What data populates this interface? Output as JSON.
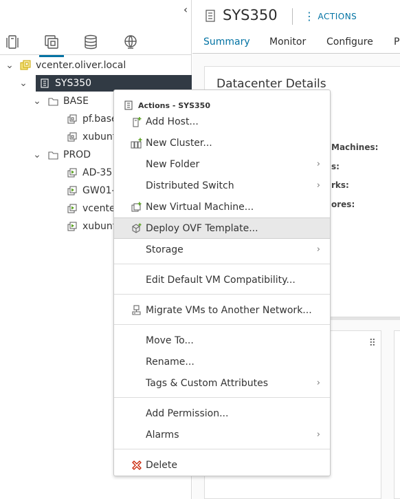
{
  "navigator": {
    "collapse_glyph": "‹",
    "tabs": [
      {
        "name": "hosts-clusters-tab",
        "icon": "hosts-clusters-icon"
      },
      {
        "name": "vms-templates-tab",
        "icon": "vms-templates-icon",
        "active": true
      },
      {
        "name": "storage-tab",
        "icon": "storage-icon"
      },
      {
        "name": "networking-tab",
        "icon": "networking-icon"
      }
    ],
    "tree": {
      "vcenter": "vcenter.oliver.local",
      "datacenter": "SYS350",
      "folder_base": "BASE",
      "base_vm1": "pf.base",
      "base_vm2": "xubunt",
      "folder_prod": "PROD",
      "prod_vm1": "AD-35",
      "prod_vm2": "GW01-",
      "prod_vm3": "vcente",
      "prod_vm4": "xubunt"
    }
  },
  "header": {
    "title": "SYS350",
    "actions_label": "ACTIONS"
  },
  "tabs": {
    "summary": "Summary",
    "monitor": "Monitor",
    "configure": "Configure",
    "permissions": "P"
  },
  "details": {
    "title": "Datacenter Details",
    "label_vms": "Machines:",
    "label_hosts": "s:",
    "label_networks": "rks:",
    "label_datastores": "ores:"
  },
  "context_menu": {
    "header": "Actions - SYS350",
    "items": {
      "add_host": "Add Host...",
      "new_cluster": "New Cluster...",
      "new_folder": "New Folder",
      "distributed_switch": "Distributed Switch",
      "new_vm": "New Virtual Machine...",
      "deploy_ovf": "Deploy OVF Template...",
      "storage": "Storage",
      "edit_compat": "Edit Default VM Compatibility...",
      "migrate_vms": "Migrate VMs to Another Network...",
      "move_to": "Move To...",
      "rename": "Rename...",
      "tags": "Tags & Custom Attributes",
      "add_permission": "Add Permission...",
      "alarms": "Alarms",
      "delete": "Delete"
    },
    "submenu_arrow": "›"
  },
  "colors": {
    "accent": "#0072a3",
    "selected_bg": "#313a44",
    "vm_green": "#5aa220",
    "delete_red": "#c92100",
    "vcenter_yellow": "#e0b800"
  }
}
